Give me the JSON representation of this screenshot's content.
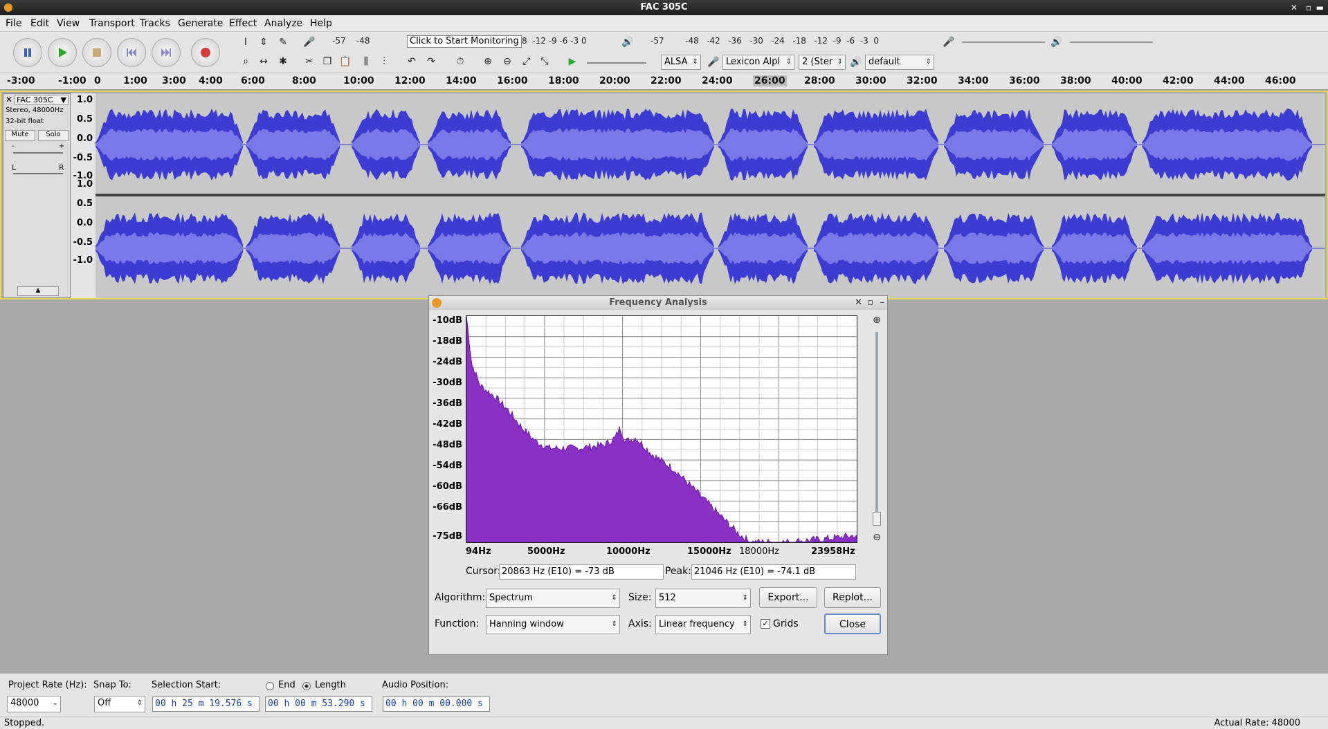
{
  "window": {
    "title": "FAC 305C"
  },
  "menu": [
    "File",
    "Edit",
    "View",
    "Transport",
    "Tracks",
    "Generate",
    "Effect",
    "Analyze",
    "Help"
  ],
  "meters": {
    "record_scale": "-57    -48",
    "monitor_label": "Click to Start Monitoring",
    "record_scale_tail": "8  -12 -9 -6 -3 0",
    "playback_scale": "-57        -48   -42   -36   -30   -24   -18   -12  -9  -6  -3  0"
  },
  "device_toolbar": {
    "host": "ALSA",
    "input_device": "Lexicon Alpl",
    "channels": "2 (Ster",
    "output_device": "default"
  },
  "ruler": {
    "ticks": [
      "-3:00",
      "-1:00",
      "0",
      "1:00",
      "3:00",
      "4:00",
      "6:00",
      "8:00",
      "10:00",
      "12:00",
      "14:00",
      "16:00",
      "18:00",
      "20:00",
      "22:00",
      "24:00",
      "26:00",
      "28:00",
      "30:00",
      "32:00",
      "34:00",
      "36:00",
      "38:00",
      "40:00",
      "42:00",
      "44:00",
      "46:00"
    ],
    "highlight": "26:00"
  },
  "track": {
    "name": "FAC 305C",
    "info_line1": "Stereo, 48000Hz",
    "info_line2": "32-bit float",
    "mute": "Mute",
    "solo": "Solo",
    "gain_minus": "-",
    "gain_plus": "+",
    "pan_left": "L",
    "pan_right": "R",
    "scale_labels": [
      "1.0",
      "0.5",
      "0.0",
      "-0.5",
      "-1.0"
    ],
    "wave_color": "#3c3cd2",
    "rms_color": "#7878e6"
  },
  "freq_dialog": {
    "title": "Frequency Analysis",
    "y_labels": [
      "-10dB",
      "-18dB",
      "-24dB",
      "-30dB",
      "-36dB",
      "-42dB",
      "-48dB",
      "-54dB",
      "-60dB",
      "-66dB",
      "-75dB"
    ],
    "x_labels": [
      "94Hz",
      "5000Hz",
      "10000Hz",
      "15000Hz",
      "18000Hz",
      "23958Hz"
    ],
    "cursor_label": "Cursor:",
    "cursor_value": "20863 Hz (E10) = -73 dB",
    "peak_label": "Peak:",
    "peak_value": "21046 Hz (E10) = -74.1 dB",
    "algorithm_label": "Algorithm:",
    "algorithm": "Spectrum",
    "size_label": "Size:",
    "size": "512",
    "export_button": "Export...",
    "replot_button": "Replot...",
    "function_label": "Function:",
    "function": "Hanning window",
    "axis_label": "Axis:",
    "axis": "Linear frequency",
    "grids_label": "Grids",
    "grids_checked": true,
    "close_button": "Close",
    "spectrum_color": "#8a30c4"
  },
  "selection_bar": {
    "project_rate_label": "Project Rate (Hz):",
    "project_rate": "48000",
    "snap_label": "Snap To:",
    "snap": "Off",
    "selection_start_label": "Selection Start:",
    "end_label": "End",
    "length_label": "Length",
    "selection_start": "00 h 25 m 19.576 s",
    "selection_length": "00 h 00 m 53.290 s",
    "audio_position_label": "Audio Position:",
    "audio_position": "00 h 00 m 00.000 s"
  },
  "status": {
    "left": "Stopped.",
    "right": "Actual Rate: 48000"
  }
}
